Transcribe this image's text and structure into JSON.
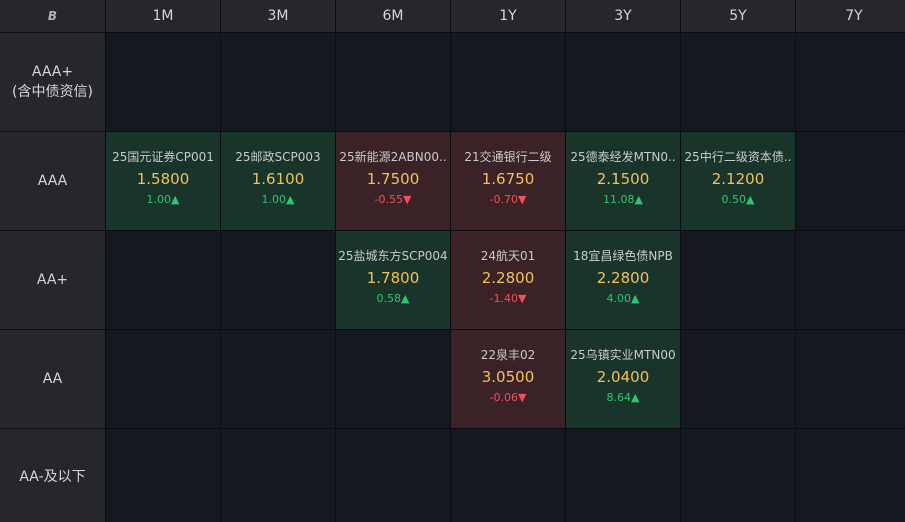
{
  "corner_label": "B",
  "colors": {
    "header_bg": "#25272b",
    "cell_bg": "#141920",
    "up_bg": "#18342b",
    "down_bg": "#3a2226",
    "yield_color": "#f2c15a",
    "up_color": "#2fc46f",
    "down_color": "#f0505a"
  },
  "columns": [
    "1M",
    "3M",
    "6M",
    "1Y",
    "3Y",
    "5Y",
    "7Y"
  ],
  "rows": [
    {
      "label_lines": [
        "AAA+",
        "(含中债资信)"
      ],
      "cells": [
        null,
        null,
        null,
        null,
        null,
        null,
        null
      ]
    },
    {
      "label_lines": [
        "AAA"
      ],
      "cells": [
        {
          "name": "25国元证券CP001",
          "yield": "1.5800",
          "change": "1.00▲",
          "dir": "up"
        },
        {
          "name": "25邮政SCP003",
          "yield": "1.6100",
          "change": "1.00▲",
          "dir": "up"
        },
        {
          "name": "25新能源2ABN00..",
          "yield": "1.7500",
          "change": "-0.55▼",
          "dir": "down"
        },
        {
          "name": "21交通银行二级",
          "yield": "1.6750",
          "change": "-0.70▼",
          "dir": "down"
        },
        {
          "name": "25德泰经发MTN0..",
          "yield": "2.1500",
          "change": "11.08▲",
          "dir": "up"
        },
        {
          "name": "25中行二级资本债..",
          "yield": "2.1200",
          "change": "0.50▲",
          "dir": "up"
        },
        null
      ]
    },
    {
      "label_lines": [
        "AA+"
      ],
      "cells": [
        null,
        null,
        {
          "name": "25盐城东方SCP004",
          "yield": "1.7800",
          "change": "0.58▲",
          "dir": "up"
        },
        {
          "name": "24航天01",
          "yield": "2.2800",
          "change": "-1.40▼",
          "dir": "down"
        },
        {
          "name": "18宜昌绿色债NPB",
          "yield": "2.2800",
          "change": "4.00▲",
          "dir": "up"
        },
        null,
        null
      ]
    },
    {
      "label_lines": [
        "AA"
      ],
      "cells": [
        null,
        null,
        null,
        {
          "name": "22泉丰02",
          "yield": "3.0500",
          "change": "-0.06▼",
          "dir": "down"
        },
        {
          "name": "25乌镇实业MTN00",
          "yield": "2.0400",
          "change": "8.64▲",
          "dir": "up"
        },
        null,
        null
      ]
    },
    {
      "label_lines": [
        "AA-及以下"
      ],
      "cells": [
        null,
        null,
        null,
        null,
        null,
        null,
        null
      ]
    }
  ]
}
